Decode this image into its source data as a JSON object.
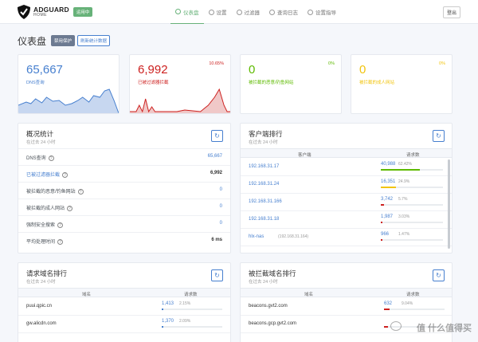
{
  "header": {
    "logo_main": "ADGUARD",
    "logo_sub": "HOME",
    "status_badge": "运用中",
    "nav": [
      {
        "label": "仪表盘"
      },
      {
        "label": "设置"
      },
      {
        "label": "过滤器"
      },
      {
        "label": "查询日志"
      },
      {
        "label": "设置指导"
      }
    ],
    "logout_label": "登出"
  },
  "page": {
    "title": "仪表盘",
    "disable_protection": "禁用保护",
    "refresh_stats": "刷新统计数据"
  },
  "stats": [
    {
      "value": "65,667",
      "label": "DNS查询",
      "percent": "",
      "color": "#467fcf"
    },
    {
      "value": "6,992",
      "label": "已被过滤器拦截",
      "percent": "10.65%",
      "color": "#cd201f"
    },
    {
      "value": "0",
      "label": "被拦截的恶意/钓鱼网站",
      "percent": "0%",
      "color": "#5eba00"
    },
    {
      "value": "0",
      "label": "被拦截的成人网站",
      "percent": "0%",
      "color": "#f1c40f"
    }
  ],
  "overview": {
    "title": "概况统计",
    "subtitle": "在过去 24 小时",
    "rows": [
      {
        "label": "DNS查询",
        "value": "65,667"
      },
      {
        "label": "已被过滤器拦截",
        "value": "6,992"
      },
      {
        "label": "被拦截的恶意/钓鱼网站",
        "value": "0"
      },
      {
        "label": "被拦截的成人网站",
        "value": "0"
      },
      {
        "label": "强制安全搜索",
        "value": "0"
      },
      {
        "label": "平均处理时间",
        "value": "6 ms"
      }
    ]
  },
  "clients": {
    "title": "客户端排行",
    "subtitle": "在过去 24 小时",
    "col_client": "客户端",
    "col_requests": "请求数",
    "rows": [
      {
        "host": "192.168.31.17",
        "count": "40,988",
        "pct": "62.42%",
        "fraction": 0.6242,
        "color": "#5eba00"
      },
      {
        "host": "192.168.31.24",
        "count": "16,351",
        "pct": "24.9%",
        "fraction": 0.249,
        "color": "#f1c40f"
      },
      {
        "host": "192.168.31.166",
        "count": "3,742",
        "pct": "5.7%",
        "fraction": 0.057,
        "color": "#cd201f"
      },
      {
        "host": "192.168.31.18",
        "count": "1,987",
        "pct": "3.03%",
        "fraction": 0.0303,
        "color": "#cd201f"
      },
      {
        "host": "hlx-nas",
        "host_ip": "(192.168.31.164)",
        "count": "966",
        "pct": "1.47%",
        "fraction": 0.0147,
        "color": "#cd201f"
      }
    ]
  },
  "queried": {
    "title": "请求域名排行",
    "subtitle": "在过去 24 小时",
    "col_domain": "域名",
    "col_requests": "请求数",
    "rows": [
      {
        "domain": "puui.qpic.cn",
        "count": "1,413",
        "pct": "2.15%",
        "fraction": 0.0215
      },
      {
        "domain": "gw.alicdn.com",
        "count": "1,370",
        "pct": "2.09%",
        "fraction": 0.0209
      }
    ]
  },
  "blocked": {
    "title": "被拦截域名排行",
    "subtitle": "在过去 24 小时",
    "col_domain": "域名",
    "col_requests": "请求数",
    "rows": [
      {
        "domain": "beacons.gvt2.com",
        "count": "632",
        "pct": "9.04%",
        "fraction": 0.0904
      },
      {
        "domain": "beacons.gcp.gvt2.com",
        "count": "",
        "pct": "",
        "fraction": 0.07
      }
    ]
  },
  "watermark": "值 什么值得买"
}
